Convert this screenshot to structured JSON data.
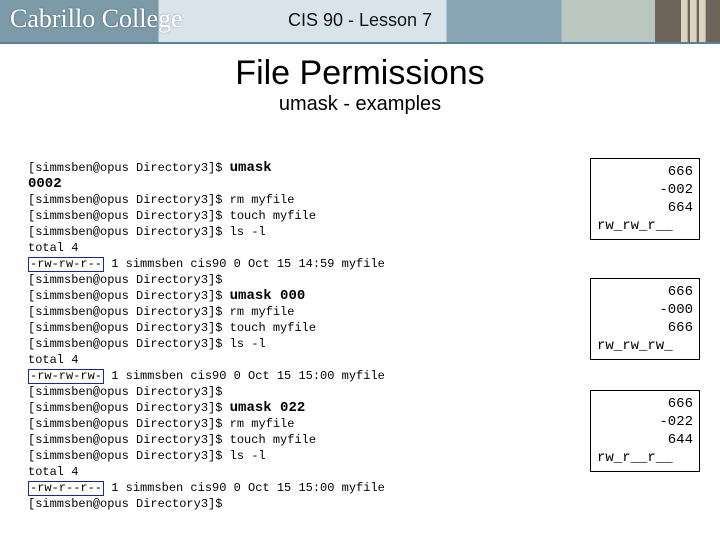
{
  "header": {
    "logo": "Cabrillo College",
    "course": "CIS 90 - Lesson 7"
  },
  "title": "File Permissions",
  "subtitle": "umask - examples",
  "terminal": {
    "prompt": "[simmsben@opus Directory3]$",
    "block1": {
      "cmd": "umask",
      "out": "0002",
      "l1": "rm myfile",
      "l2": "touch myfile",
      "l3": "ls -l",
      "l4": "total 4",
      "perm": "-rw-rw-r--",
      "rest": " 1 simmsben cis90 0 Oct 15 14:59 myfile"
    },
    "block2": {
      "cmd": "umask 000",
      "l1": "rm myfile",
      "l2": "touch myfile",
      "l3": "ls -l",
      "l4": "total 4",
      "perm": "-rw-rw-rw-",
      "rest": " 1 simmsben cis90 0 Oct 15 15:00 myfile"
    },
    "block3": {
      "cmd": "umask 022",
      "l1": "rm myfile",
      "l2": "touch myfile",
      "l3": "ls -l",
      "l4": "total 4",
      "perm": "-rw-r--r--",
      "rest": " 1 simmsben cis90 0 Oct 15 15:00 myfile"
    }
  },
  "calcs": {
    "c1": {
      "a": "666",
      "b": "-002",
      "r": "664",
      "sym": "rw_rw_r__"
    },
    "c2": {
      "a": "666",
      "b": "-000",
      "r": "666",
      "sym": "rw_rw_rw_"
    },
    "c3": {
      "a": "666",
      "b": "-022",
      "r": "644",
      "sym": "rw_r__r__"
    }
  }
}
